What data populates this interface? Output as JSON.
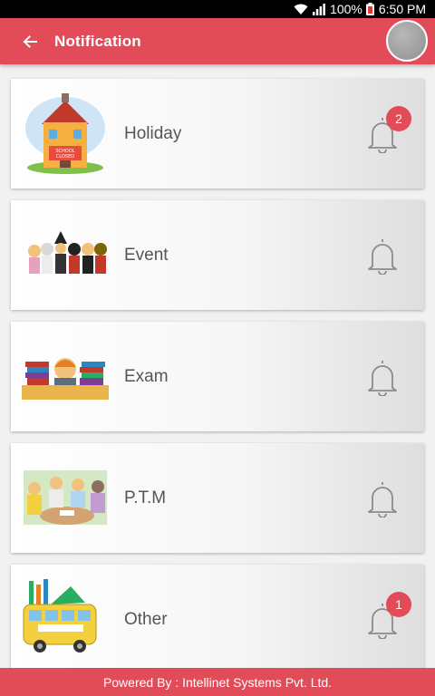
{
  "status_bar": {
    "battery": "100%",
    "time": "6:50 PM"
  },
  "app_bar": {
    "title": "Notification",
    "back_icon": "arrow-left-icon"
  },
  "notifications": [
    {
      "label": "Holiday",
      "badge": "2",
      "image": "school-closed"
    },
    {
      "label": "Event",
      "badge": null,
      "image": "kids-costumes"
    },
    {
      "label": "Exam",
      "badge": null,
      "image": "student-books"
    },
    {
      "label": "P.T.M",
      "badge": null,
      "image": "parents-teacher-meeting"
    },
    {
      "label": "Other",
      "badge": "1",
      "image": "school-bus"
    }
  ],
  "footer": {
    "text": "Powered By : Intellinet Systems Pvt. Ltd."
  },
  "colors": {
    "accent": "#e24c59",
    "label": "#555555",
    "bell": "#8a8a8a"
  }
}
